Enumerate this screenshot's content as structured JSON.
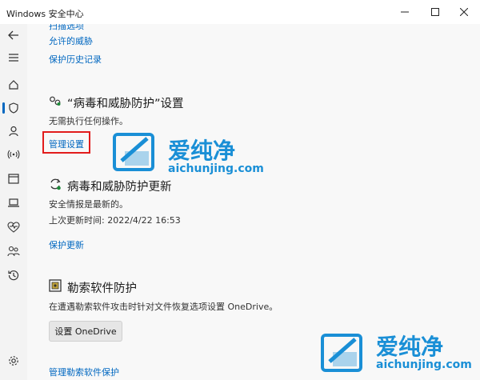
{
  "window": {
    "title": "Windows 安全中心",
    "minimize_icon": "minimize-icon",
    "maximize_icon": "maximize-icon",
    "close_icon": "close-icon"
  },
  "sidebar": {
    "items": [
      {
        "icon": "back-icon",
        "glyph": "←"
      },
      {
        "icon": "menu-icon",
        "glyph": "≡"
      },
      {
        "icon": "home-icon",
        "glyph": "⌂"
      },
      {
        "icon": "shield-icon",
        "glyph": "⛉",
        "active": true
      },
      {
        "icon": "person-icon",
        "glyph": "♙"
      },
      {
        "icon": "wifi-icon",
        "glyph": "((·))"
      },
      {
        "icon": "app-window-icon",
        "glyph": "▭"
      },
      {
        "icon": "laptop-icon",
        "glyph": "💻"
      },
      {
        "icon": "heart-icon",
        "glyph": "♡"
      },
      {
        "icon": "family-icon",
        "glyph": "⚇"
      },
      {
        "icon": "history-icon",
        "glyph": "↺"
      },
      {
        "icon": "gear-icon",
        "glyph": "⚙"
      }
    ]
  },
  "top_links": {
    "partial": "扫描选项",
    "allowed_threats": "允许的威胁",
    "protection_history": "保护历史记录"
  },
  "settings_section": {
    "title": "“病毒和威胁防护”设置",
    "subtitle": "无需执行任何操作。",
    "manage_link": "管理设置"
  },
  "updates_section": {
    "title": "病毒和威胁防护更新",
    "status": "安全情报是最新的。",
    "last_update": "上次更新时间: 2022/4/22 16:53",
    "update_link": "保护更新"
  },
  "ransomware_section": {
    "title": "勒索软件防护",
    "description": "在遭遇勒索软件攻击时针对文件恢复选项设置 OneDrive。",
    "button": "设置 OneDrive",
    "manage_link": "管理勒索软件保护"
  },
  "watermark": {
    "name": "爱纯净",
    "url": "aichunjing.com",
    "color": "#1a8fd6"
  }
}
